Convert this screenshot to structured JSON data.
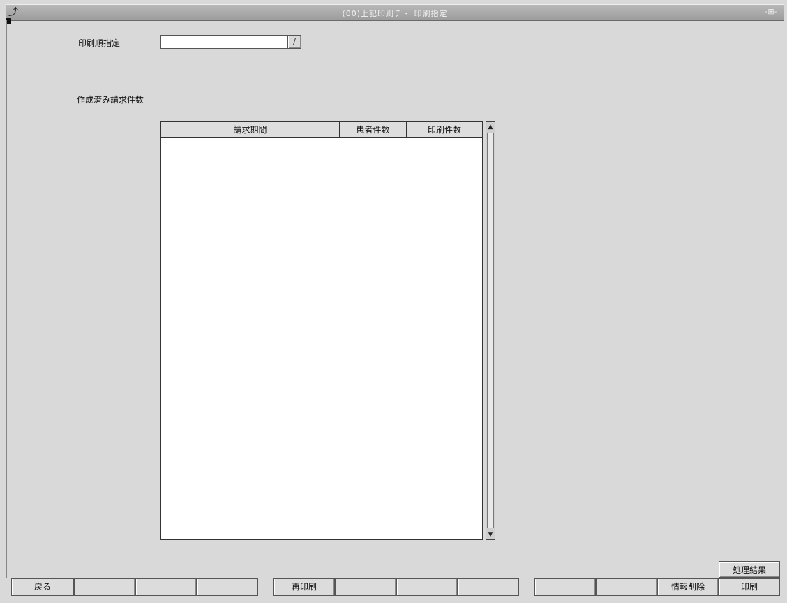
{
  "window": {
    "title": "(00)上記印刷チ・ 印刷指定",
    "app_icon": "app-icon",
    "control_label": "-⊞-"
  },
  "form": {
    "print_order_label": "印刷順指定",
    "print_order_value": "",
    "dropdown_icon": "chevron-down-icon",
    "section_label": "作成済み請求件数"
  },
  "table": {
    "columns": [
      "請求期間",
      "患者件数",
      "印刷件数"
    ],
    "rows": []
  },
  "function_keys": [
    {
      "label": "戻る"
    },
    {
      "label": ""
    },
    {
      "label": ""
    },
    {
      "label": ""
    },
    {
      "label": "再印刷"
    },
    {
      "label": ""
    },
    {
      "label": ""
    },
    {
      "label": ""
    },
    {
      "label": ""
    },
    {
      "label": ""
    },
    {
      "label": "情報削除"
    },
    {
      "label": "印刷"
    }
  ],
  "extra_button": {
    "label": "処理結果"
  },
  "colors": {
    "background": "#d9d9d9",
    "titlebar": "#a8a8a8",
    "table_bg": "#ffffff"
  }
}
